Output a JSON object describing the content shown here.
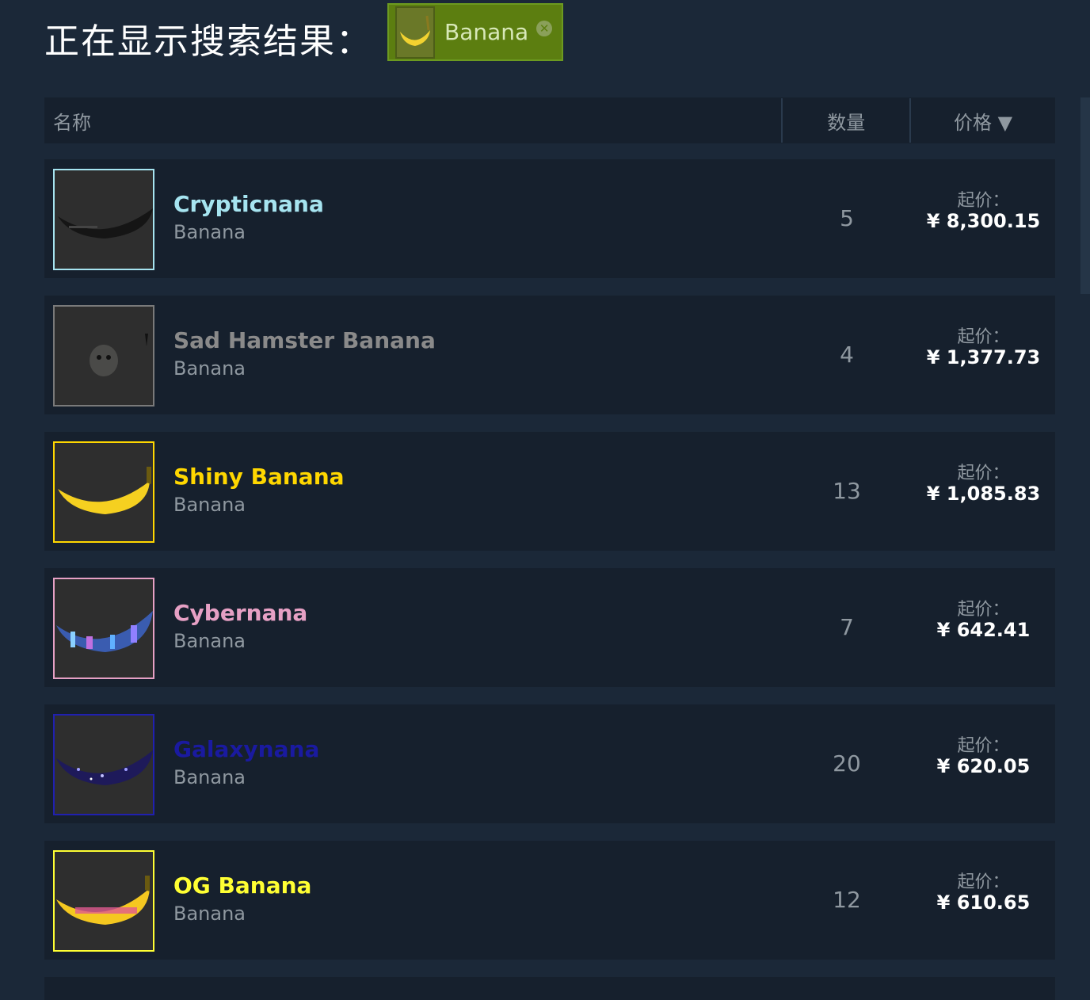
{
  "header": {
    "title": "正在显示搜索结果：",
    "filter_tag": {
      "label": "Banana",
      "remove_icon": "close-circle-icon"
    }
  },
  "table": {
    "columns": {
      "name": "名称",
      "quantity": "数量",
      "price": "价格 ▼"
    },
    "rows": [
      {
        "name": "Crypticnana",
        "game": "Banana",
        "quantity": "5",
        "price_label": "起价：",
        "price": "¥ 8,300.15",
        "name_color": "#a6e4f0",
        "border_color": "#a6e4f0"
      },
      {
        "name": "Sad Hamster Banana",
        "game": "Banana",
        "quantity": "4",
        "price_label": "起价：",
        "price": "¥ 1,377.73",
        "name_color": "#8a8a8a",
        "border_color": "#7a7a7a"
      },
      {
        "name": "Shiny Banana",
        "game": "Banana",
        "quantity": "13",
        "price_label": "起价：",
        "price": "¥ 1,085.83",
        "name_color": "#ffd700",
        "border_color": "#ffd700"
      },
      {
        "name": "Cybernana",
        "game": "Banana",
        "quantity": "7",
        "price_label": "起价：",
        "price": "¥ 642.41",
        "name_color": "#e6a0c4",
        "border_color": "#e6a0c4"
      },
      {
        "name": "Galaxynana",
        "game": "Banana",
        "quantity": "20",
        "price_label": "起价：",
        "price": "¥ 620.05",
        "name_color": "#1a1aa0",
        "border_color": "#2020b0"
      },
      {
        "name": "OG Banana",
        "game": "Banana",
        "quantity": "12",
        "price_label": "起价：",
        "price": "¥ 610.65",
        "name_color": "#ffff33",
        "border_color": "#ffff33"
      }
    ]
  }
}
